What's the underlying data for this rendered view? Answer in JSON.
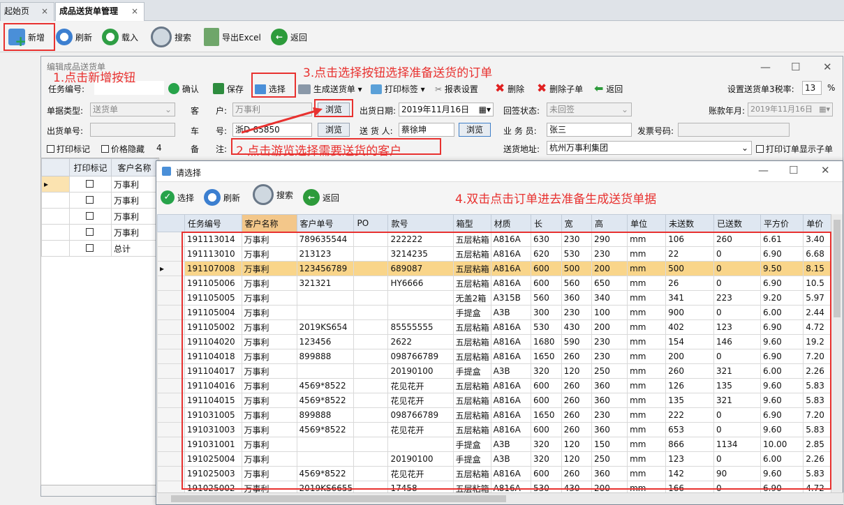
{
  "tabs": [
    {
      "label": "起始页",
      "close": "×"
    },
    {
      "label": "成品送货单管理",
      "close": "×"
    }
  ],
  "toolbar": {
    "add": "新增",
    "refresh": "刷新",
    "load": "载入",
    "search": "搜索",
    "export": "导出Excel",
    "back": "返回"
  },
  "annotations": {
    "step1": "1.点击新增按钮",
    "step2": "2.点击游览选择需要送货的客户",
    "step3": "3.点击选择按钮选择准备送货的订单",
    "step4": "4.双击点击订单进去准备生成送货单据"
  },
  "editor": {
    "title": "编辑成品送货单",
    "win_min": "—",
    "win_max": "☐",
    "win_close": "✕",
    "toolbar": {
      "task_no_label": "任务编号:",
      "confirm": "确认",
      "save": "保存",
      "select": "选择",
      "generate": "生成送货单",
      "print_label": "打印标签",
      "report_setting": "报表设置",
      "delete": "删除",
      "delete_child": "删除子单",
      "back": "返回",
      "tax_label": "设置送货单3税率:",
      "tax_value": "13",
      "tax_unit": "%"
    },
    "form": {
      "doc_type_label": "单据类型:",
      "doc_type_value": "送货单",
      "customer_label": "客",
      "customer_label2": "户:",
      "customer_value": "万事利",
      "browse": "浏览",
      "ship_date_label": "出货日期:",
      "ship_date_value": "2019年11月16日",
      "sign_status_label": "回签状态:",
      "sign_status_value": "未回签",
      "account_month_label": "账款年月:",
      "account_month_value": "2019年11月16日",
      "ship_no_label": "出货单号:",
      "ship_no_value": "",
      "plate_label": "车",
      "plate_label2": "号:",
      "plate_value": "浙D-85850",
      "deliverer_label": "送 货 人:",
      "deliverer_value": "蔡徐坤",
      "salesman_label": "业 务 员:",
      "salesman_value": "张三",
      "invoice_label": "发票号码:",
      "invoice_value": "",
      "print_mark": "打印标记",
      "price_hide": "价格隐藏",
      "count": "4",
      "remark_label": "备",
      "remark_label2": "注:",
      "address_label": "送货地址:",
      "address_value": "杭州万事利集团",
      "print_child": "打印订单显示子单"
    },
    "left_grid": {
      "headers": [
        "打印标记",
        "客户名称"
      ],
      "rows": [
        "万事利",
        "万事利",
        "万事利",
        "万事利",
        "总计"
      ]
    }
  },
  "dialog": {
    "title": "请选择",
    "min": "—",
    "max": "☐",
    "close": "✕",
    "toolbar": {
      "select": "选择",
      "refresh": "刷新",
      "search": "搜索",
      "back": "返回"
    },
    "columns": [
      "任务编号",
      "客户名称",
      "客户单号",
      "PO",
      "款号",
      "箱型",
      "材质",
      "长",
      "宽",
      "高",
      "单位",
      "未送数",
      "已送数",
      "平方价",
      "单价"
    ],
    "rows": [
      [
        "191113014",
        "万事利",
        "789635544",
        "",
        "222222",
        "五层粘箱",
        "A816A",
        "630",
        "230",
        "290",
        "mm",
        "106",
        "260",
        "6.61",
        "3.40"
      ],
      [
        "191113010",
        "万事利",
        "213123",
        "",
        "3214235",
        "五层粘箱",
        "A816A",
        "620",
        "530",
        "230",
        "mm",
        "22",
        "0",
        "6.90",
        "6.68"
      ],
      [
        "191107008",
        "万事利",
        "123456789",
        "",
        "689087",
        "五层粘箱",
        "A816A",
        "600",
        "500",
        "200",
        "mm",
        "500",
        "0",
        "9.50",
        "8.15"
      ],
      [
        "191105006",
        "万事利",
        "321321",
        "",
        "HY6666",
        "五层粘箱",
        "A816A",
        "600",
        "560",
        "650",
        "mm",
        "26",
        "0",
        "6.90",
        "10.5"
      ],
      [
        "191105005",
        "万事利",
        "",
        "",
        "",
        "无盖2箱",
        "A315B",
        "560",
        "360",
        "340",
        "mm",
        "341",
        "223",
        "9.20",
        "5.97"
      ],
      [
        "191105004",
        "万事利",
        "",
        "",
        "",
        "手提盒",
        "A3B",
        "300",
        "230",
        "100",
        "mm",
        "900",
        "0",
        "6.00",
        "2.44"
      ],
      [
        "191105002",
        "万事利",
        "2019KS654",
        "",
        "85555555",
        "五层粘箱",
        "A816A",
        "530",
        "430",
        "200",
        "mm",
        "402",
        "123",
        "6.90",
        "4.72"
      ],
      [
        "191104020",
        "万事利",
        "123456",
        "",
        "2622",
        "五层粘箱",
        "A816A",
        "1680",
        "590",
        "230",
        "mm",
        "154",
        "146",
        "9.60",
        "19.2"
      ],
      [
        "191104018",
        "万事利",
        "899888",
        "",
        "098766789",
        "五层粘箱",
        "A816A",
        "1650",
        "260",
        "230",
        "mm",
        "200",
        "0",
        "6.90",
        "7.20"
      ],
      [
        "191104017",
        "万事利",
        "",
        "",
        "20190100",
        "手提盒",
        "A3B",
        "320",
        "120",
        "250",
        "mm",
        "260",
        "321",
        "6.00",
        "2.26"
      ],
      [
        "191104016",
        "万事利",
        "4569*8522",
        "",
        "花见花开",
        "五层粘箱",
        "A816A",
        "600",
        "260",
        "360",
        "mm",
        "126",
        "135",
        "9.60",
        "5.83"
      ],
      [
        "191104015",
        "万事利",
        "4569*8522",
        "",
        "花见花开",
        "五层粘箱",
        "A816A",
        "600",
        "260",
        "360",
        "mm",
        "135",
        "321",
        "9.60",
        "5.83"
      ],
      [
        "191031005",
        "万事利",
        "899888",
        "",
        "098766789",
        "五层粘箱",
        "A816A",
        "1650",
        "260",
        "230",
        "mm",
        "222",
        "0",
        "6.90",
        "7.20"
      ],
      [
        "191031003",
        "万事利",
        "4569*8522",
        "",
        "花见花开",
        "五层粘箱",
        "A816A",
        "600",
        "260",
        "360",
        "mm",
        "653",
        "0",
        "9.60",
        "5.83"
      ],
      [
        "191031001",
        "万事利",
        "",
        "",
        "",
        "手提盒",
        "A3B",
        "320",
        "120",
        "150",
        "mm",
        "866",
        "1134",
        "10.00",
        "2.85"
      ],
      [
        "191025004",
        "万事利",
        "",
        "",
        "20190100",
        "手提盒",
        "A3B",
        "320",
        "120",
        "250",
        "mm",
        "123",
        "0",
        "6.00",
        "2.26"
      ],
      [
        "191025003",
        "万事利",
        "4569*8522",
        "",
        "花见花开",
        "五层粘箱",
        "A816A",
        "600",
        "260",
        "360",
        "mm",
        "142",
        "90",
        "9.60",
        "5.83"
      ],
      [
        "191025002",
        "万事利",
        "2019KS6655",
        "",
        "17458",
        "五层粘箱",
        "A816A",
        "530",
        "430",
        "200",
        "mm",
        "166",
        "0",
        "6.90",
        "4.72"
      ]
    ],
    "selected_row": 2
  }
}
